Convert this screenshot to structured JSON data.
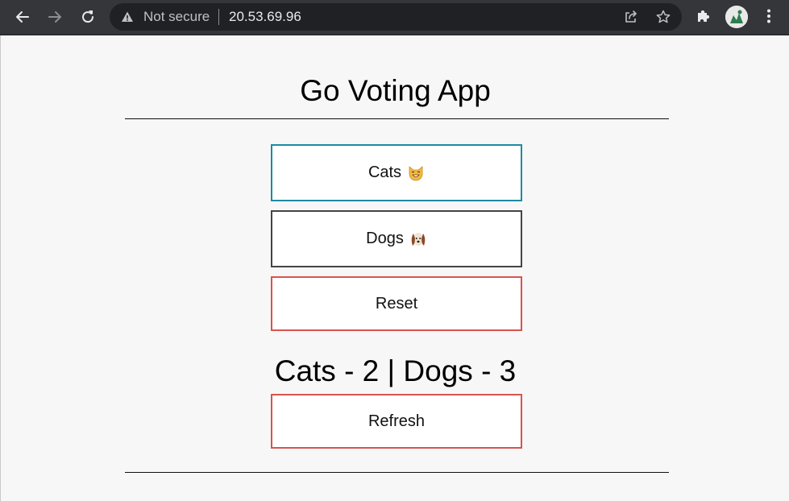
{
  "browser": {
    "security_label": "Not secure",
    "url": "20.53.69.96",
    "icons": [
      "back-icon",
      "forward-icon",
      "reload-icon",
      "warning-icon",
      "share-icon",
      "bookmark-star-icon",
      "extensions-puzzle-icon",
      "profile-avatar",
      "more-menu-icon"
    ]
  },
  "app": {
    "title": "Go Voting App",
    "buttons": {
      "cats": {
        "label": "Cats",
        "emoji": "smiling-cat-emoji",
        "border": "#1c8ba3"
      },
      "dogs": {
        "label": "Dogs",
        "emoji": "dog-face-emoji",
        "border": "#444444"
      },
      "reset": {
        "label": "Reset",
        "border": "#d9534f"
      },
      "refresh": {
        "label": "Refresh",
        "border": "#d9534f"
      }
    },
    "results": {
      "text": "Cats - 2 | Dogs - 3",
      "cats": 2,
      "dogs": 3
    }
  }
}
